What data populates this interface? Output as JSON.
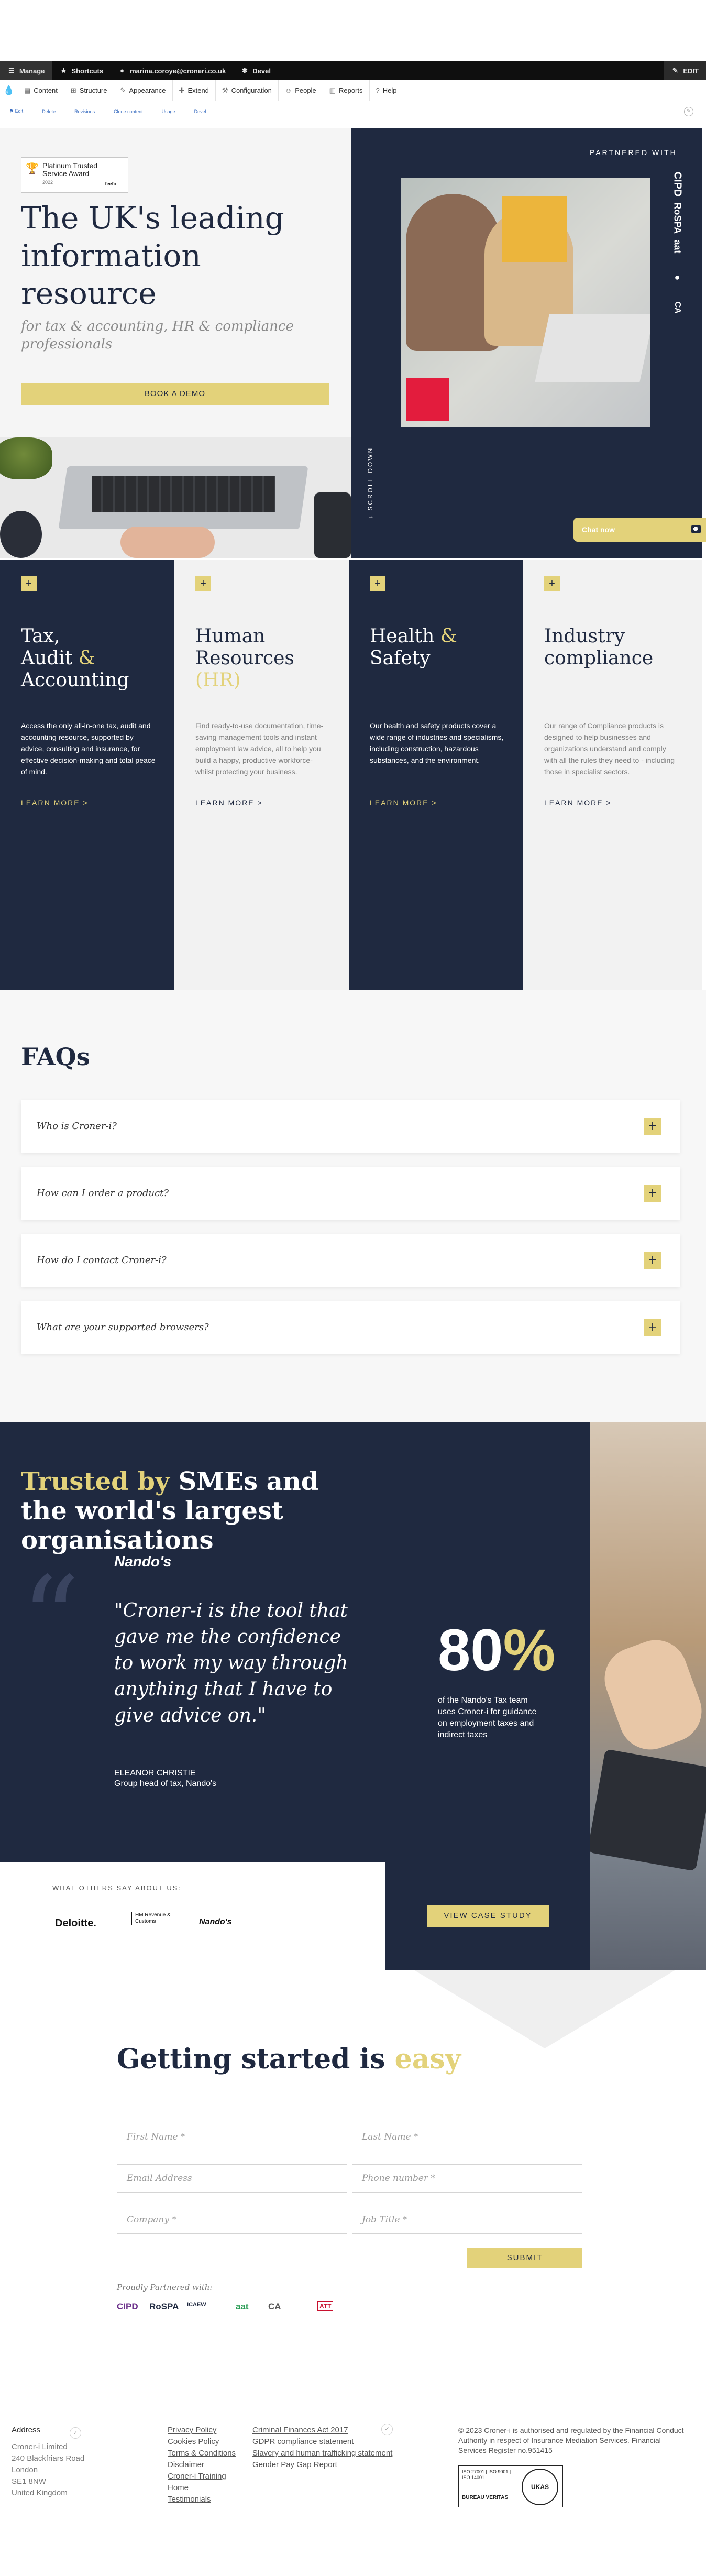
{
  "toolbar": {
    "manage": "Manage",
    "shortcuts": "Shortcuts",
    "user": "marina.coroye@croneri.co.uk",
    "devel": "Devel",
    "edit": "EDIT"
  },
  "tray": {
    "items": [
      "Content",
      "Structure",
      "Appearance",
      "Extend",
      "Configuration",
      "People",
      "Reports",
      "Help"
    ]
  },
  "tabs": [
    "⚑ Edit",
    "Delete",
    "Revisions",
    "Clone content",
    "Usage",
    "Devel"
  ],
  "hero": {
    "badge_line1": "Platinum Trusted",
    "badge_line2": "Service Award",
    "badge_year": "2022",
    "badge_brand": "feefo",
    "title": "The UK's leading information resource",
    "subtitle": "for tax & accounting, HR & compliance professionals",
    "demo_button": "BOOK A DEMO",
    "partnered": "PARTNERED WITH",
    "partner_logos": [
      "CIPD",
      "RoSPA",
      "aat",
      "●",
      "CA"
    ],
    "scroll": "SCROLL DOWN",
    "chat": "Chat now"
  },
  "cards": [
    {
      "title_a": "Tax,",
      "title_b": "Audit ",
      "title_gold": "&",
      "title_c": "Accounting",
      "text": "Access the only all-in-one tax, audit and accounting resource, supported by advice, consulting and insurance, for effective decision-making and total peace of mind.",
      "more": "LEARN MORE >"
    },
    {
      "title_a": "Human",
      "title_b": "Resources",
      "title_gold": "(HR)",
      "title_c": "",
      "text": "Find ready-to-use documentation, time-saving management tools and instant employment law advice, all to help you build a happy, productive workforce-whilst protecting your business.",
      "more": "LEARN MORE >"
    },
    {
      "title_a": "Health ",
      "title_gold": "&",
      "title_b": "Safety",
      "title_c": "",
      "text": "Our health and safety products cover a wide range of industries and specialisms, including construction, hazardous substances, and the environment.",
      "more": "LEARN MORE >"
    },
    {
      "title_a": "Industry",
      "title_b": "compliance",
      "title_gold": "",
      "title_c": "",
      "text": "Our range of Compliance products is designed to help businesses and organizations understand and comply with all the rules they need to - including those in specialist sectors.",
      "more": "LEARN MORE >"
    }
  ],
  "faqs": {
    "title": "FAQs",
    "items": [
      "Who is Croner-i?",
      "How can I order a product?",
      "How do I contact Croner-i?",
      "What are your supported browsers?"
    ]
  },
  "trusted": {
    "gold": "Trusted by",
    "rest": "SMEs and the world's largest organisations",
    "brand": "Nando's",
    "quote": "\"Croner-i is the tool that gave me the confidence to work my way through anything that I have to give advice on.\"",
    "name": "ELEANOR CHRISTIE",
    "role": "Group head of tax, Nando's",
    "stat_num": "80",
    "stat_pct": "%",
    "stat_text": "of the Nando's Tax team uses Croner-i for guidance on employment taxes and indirect taxes",
    "case_button": "VIEW CASE STUDY",
    "others": "WHAT OTHERS SAY ABOUT US:",
    "logos": [
      "Deloitte.",
      "HM Revenue & Customs",
      "Nando's"
    ]
  },
  "form": {
    "title": "Getting started is",
    "title_gold": "easy",
    "first": "First Name *",
    "last": "Last Name *",
    "email": "Email Address",
    "phone": "Phone number *",
    "company": "Company *",
    "job": "Job Title *",
    "submit": "SUBMIT",
    "partnered": "Proudly Partnered with:",
    "partner_logos": [
      "CIPD",
      "RoSPA",
      "ICAEW",
      "aat",
      "CA",
      "ATT"
    ]
  },
  "footer": {
    "address_title": "Address",
    "address": [
      "Croner-i Limited",
      "240 Blackfriars Road",
      "London",
      "SE1 8NW",
      "United Kingdom"
    ],
    "links1": [
      "Privacy Policy",
      "Cookies Policy",
      "Terms & Conditions",
      "Disclaimer",
      "Croner-i Training",
      "Home",
      "Testimonials"
    ],
    "links2": [
      "Criminal Finances Act 2017",
      "GDPR compliance statement",
      "Slavery and human trafficking statement",
      "Gender Pay Gap Report"
    ],
    "legal": "© 2023 Croner-i is authorised and regulated by the Financial Conduct Authority in respect of Insurance Mediation Services. Financial Services Register no.951415",
    "cert_text": "ISO 27001 | ISO 9001 | ISO 14001",
    "cert_brand": "BUREAU VERITAS",
    "cert_seal": "UKAS"
  }
}
